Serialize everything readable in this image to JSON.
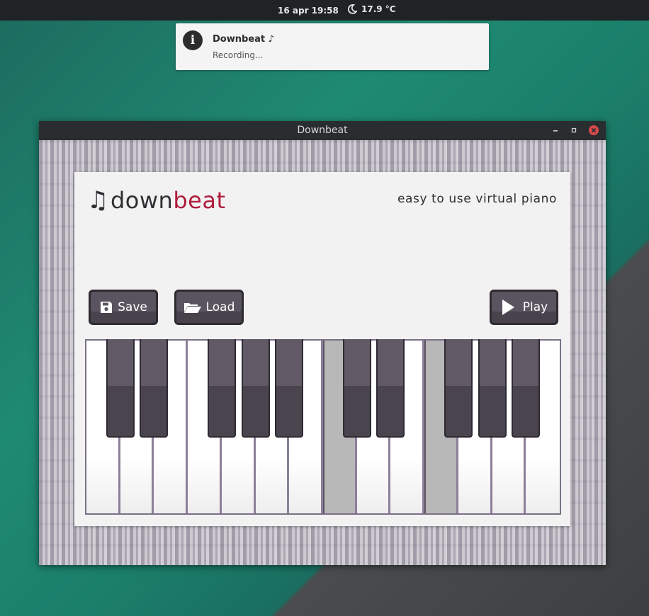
{
  "topbar": {
    "clock": "16 apr  19:58",
    "temperature": "17.9 °C",
    "weather_icon": "moon-icon"
  },
  "notification": {
    "icon": "info-icon",
    "title": "Downbeat ♪",
    "body": "Recording..."
  },
  "window": {
    "title": "Downbeat",
    "controls": [
      "minimize",
      "restore",
      "close"
    ]
  },
  "app": {
    "logo_note": "♫",
    "logo_prefix": "down",
    "logo_suffix": "beat",
    "logo_accent_color": "#b01c3d",
    "tagline": "easy to use virtual piano",
    "buttons": {
      "save_label": "Save",
      "load_label": "Load",
      "play_label": "Play"
    }
  },
  "piano": {
    "white_key_count": 14,
    "pressed_white_keys": [
      7,
      10
    ],
    "black_key_count": 10
  }
}
